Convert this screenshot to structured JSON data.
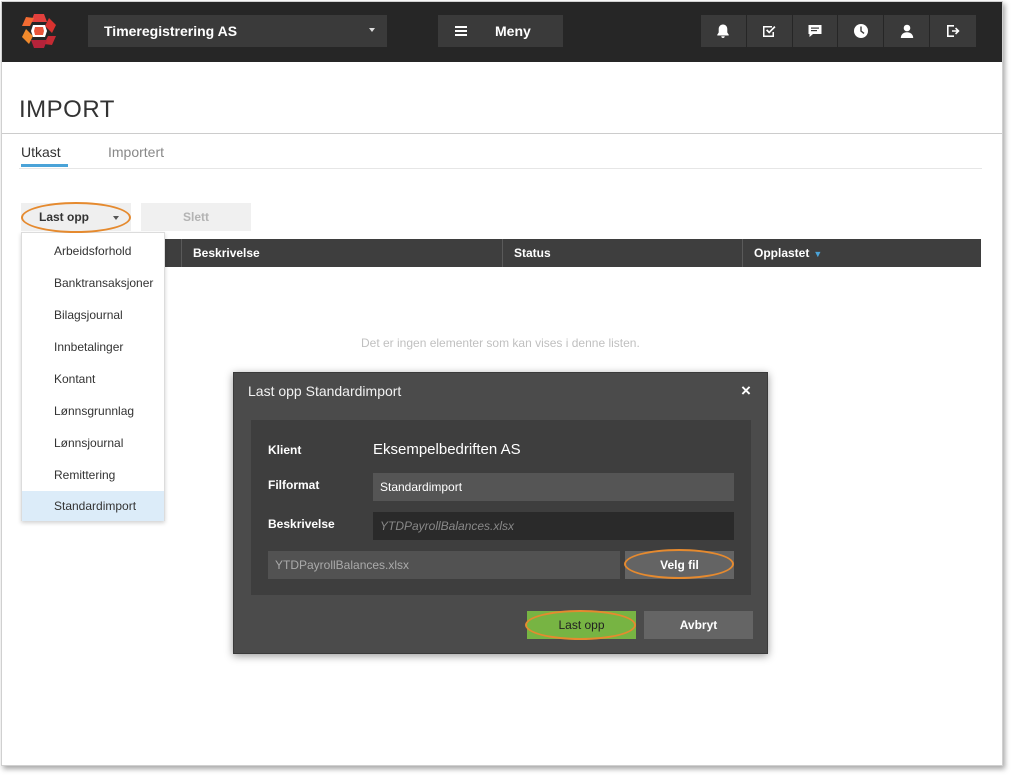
{
  "header": {
    "company_name": "Timeregistrering AS",
    "menu_label": "Meny",
    "icons": [
      "bell-icon",
      "checklist-icon",
      "chat-icon",
      "clock-icon",
      "user-icon",
      "logout-icon"
    ]
  },
  "page": {
    "title": "IMPORT",
    "tabs": [
      {
        "label": "Utkast",
        "active": true
      },
      {
        "label": "Importert",
        "active": false
      }
    ]
  },
  "toolbar": {
    "upload_label": "Last opp",
    "delete_label": "Slett"
  },
  "upload_menu": {
    "items": [
      "Arbeidsforhold",
      "Banktransaksjoner",
      "Bilagsjournal",
      "Innbetalinger",
      "Kontant",
      "Lønnsgrunnlag",
      "Lønnsjournal",
      "Remittering",
      "Standardimport"
    ],
    "selected": "Standardimport"
  },
  "table": {
    "columns": [
      "Beskrivelse",
      "Status",
      "Opplastet"
    ],
    "sorted_column": "Opplastet",
    "empty_text": "Det er ingen elementer som kan vises i denne listen."
  },
  "modal": {
    "title": "Last opp Standardimport",
    "close_symbol": "×",
    "client_label": "Klient",
    "client_value": "Eksempelbedriften AS",
    "format_label": "Filformat",
    "format_value": "Standardimport",
    "description_label": "Beskrivelse",
    "description_placeholder": "YTDPayrollBalances.xlsx",
    "file_name": "YTDPayrollBalances.xlsx",
    "choose_file_label": "Velg fil",
    "upload_label": "Last opp",
    "cancel_label": "Avbryt"
  },
  "colors": {
    "topbar": "#262626",
    "accent_blue": "#4aa3d8",
    "highlight_orange": "#e58a2f",
    "upload_green": "#77b443",
    "modal_bg": "#4b4b4b"
  }
}
